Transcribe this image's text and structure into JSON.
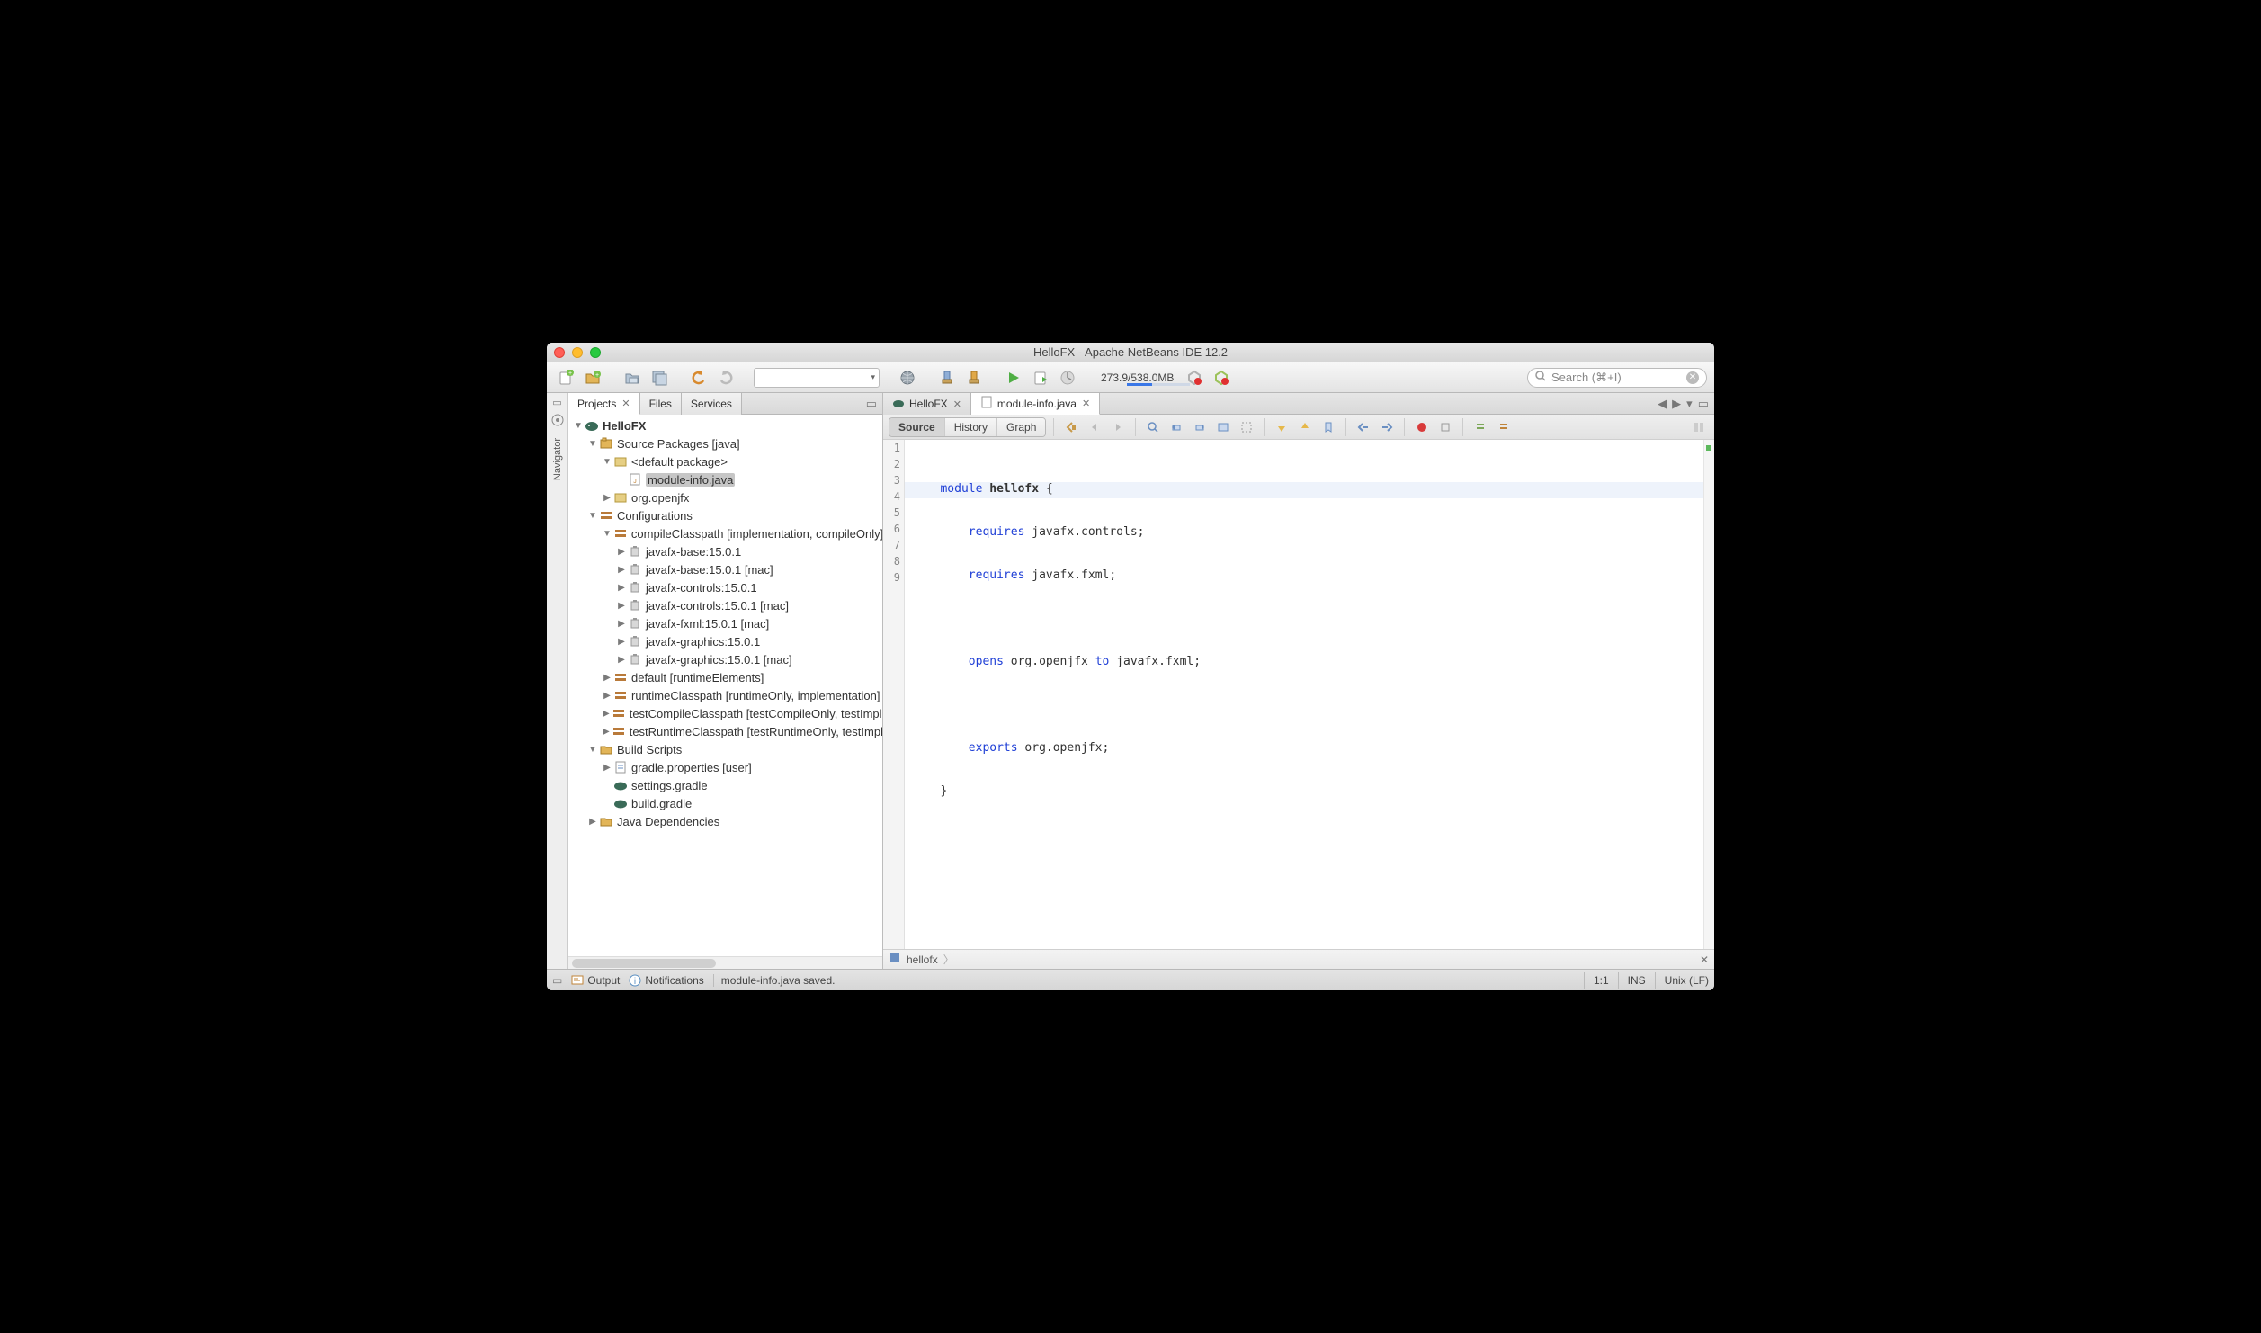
{
  "window": {
    "title": "HelloFX - Apache NetBeans IDE 12.2"
  },
  "toolbar": {
    "memory": "273.9/538.0MB",
    "search_placeholder": "Search (⌘+I)"
  },
  "navigator": {
    "label": "Navigator"
  },
  "leftpanel": {
    "tabs": [
      {
        "label": "Projects",
        "active": true,
        "closable": true
      },
      {
        "label": "Files",
        "active": false,
        "closable": false
      },
      {
        "label": "Services",
        "active": false,
        "closable": false
      }
    ],
    "tree": {
      "project": "HelloFX",
      "source_packages": "Source Packages [java]",
      "default_pkg": "<default package>",
      "module_info": "module-info.java",
      "org_openjfx": "org.openjfx",
      "configurations": "Configurations",
      "compileClasspath": "compileClasspath [implementation, compileOnly]",
      "jars": [
        "javafx-base:15.0.1",
        "javafx-base:15.0.1 [mac]",
        "javafx-controls:15.0.1",
        "javafx-controls:15.0.1 [mac]",
        "javafx-fxml:15.0.1 [mac]",
        "javafx-graphics:15.0.1",
        "javafx-graphics:15.0.1 [mac]"
      ],
      "default_runtime": "default [runtimeElements]",
      "runtimeClasspath": "runtimeClasspath [runtimeOnly, implementation]",
      "testCompileClasspath": "testCompileClasspath [testCompileOnly, testImplementation]",
      "testRuntimeClasspath": "testRuntimeClasspath [testRuntimeOnly, testImplementation]",
      "build_scripts": "Build Scripts",
      "gradle_props": "gradle.properties [user]",
      "settings_gradle": "settings.gradle",
      "build_gradle": "build.gradle",
      "java_deps": "Java Dependencies"
    }
  },
  "editor": {
    "tabs": [
      {
        "label": "HelloFX",
        "active": false
      },
      {
        "label": "module-info.java",
        "active": true
      }
    ],
    "views": {
      "source": "Source",
      "history": "History",
      "graph": "Graph"
    },
    "breadcrumb": "hellofx",
    "code": {
      "lines": 9,
      "l1_kw": "module",
      "l1_name": "hellofx",
      "l1_tail": " {",
      "l2_kw": "requires",
      "l2_rest": " javafx.controls;",
      "l3_kw": "requires",
      "l3_rest": " javafx.fxml;",
      "l5_kw": "opens",
      "l5_mid": " org.openjfx ",
      "l5_kw2": "to",
      "l5_rest": " javafx.fxml;",
      "l7_kw": "exports",
      "l7_rest": " org.openjfx;",
      "l8": "}"
    }
  },
  "statusbar": {
    "output": "Output",
    "notifications": "Notifications",
    "message": "module-info.java saved.",
    "cursor": "1:1",
    "ins": "INS",
    "eol": "Unix (LF)"
  }
}
